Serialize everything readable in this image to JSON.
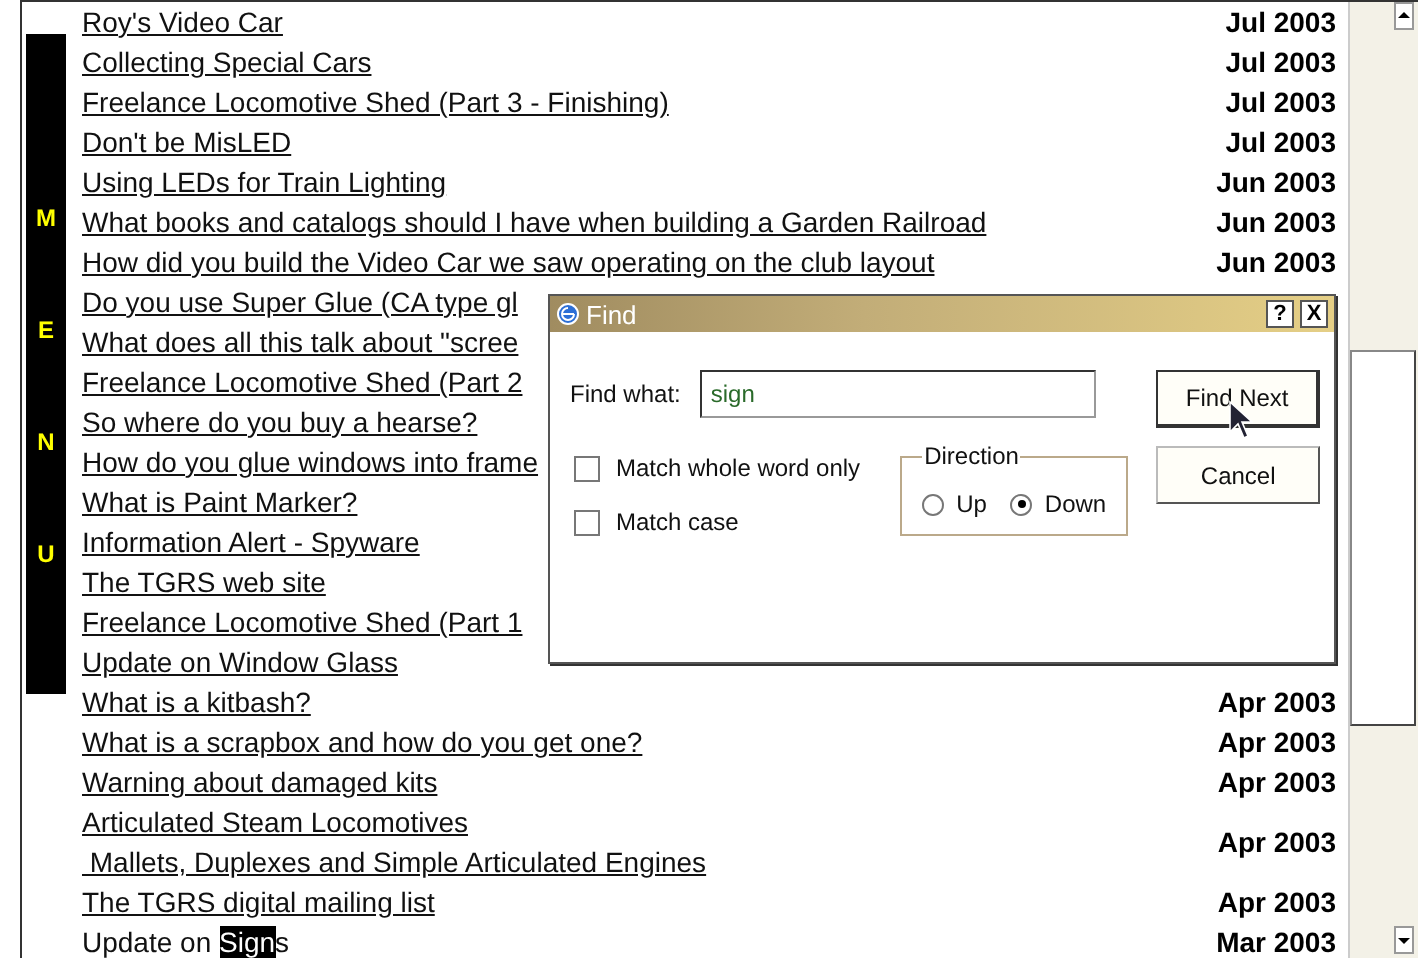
{
  "menu_bar": {
    "letters": [
      "M",
      "E",
      "N",
      "U"
    ]
  },
  "articles": [
    {
      "kind": "link",
      "title": "Roy's Video Car",
      "date": "Jul 2003"
    },
    {
      "kind": "link",
      "title": "Collecting Special Cars",
      "date": "Jul 2003"
    },
    {
      "kind": "link",
      "title": "Freelance Locomotive Shed (Part 3 - Finishing)",
      "date": "Jul 2003"
    },
    {
      "kind": "link",
      "title": "Don't be MisLED",
      "date": "Jul 2003"
    },
    {
      "kind": "link",
      "title": "Using LEDs for Train Lighting",
      "date": "Jun 2003"
    },
    {
      "kind": "link",
      "title": "What books and catalogs should I have when building a Garden Railroad",
      "date": "Jun 2003"
    },
    {
      "kind": "link",
      "title": "How did you build the Video Car we saw operating on the club layout",
      "date": "Jun 2003"
    },
    {
      "kind": "link",
      "title": "Do you use Super Glue (CA type gl"
    },
    {
      "kind": "link",
      "title": "What does all this talk about \"scree"
    },
    {
      "kind": "link",
      "title": "Freelance Locomotive Shed (Part 2"
    },
    {
      "kind": "link",
      "title": "So where do you buy a hearse?"
    },
    {
      "kind": "link",
      "title": "How do you glue windows into frame"
    },
    {
      "kind": "link",
      "title": "What is Paint Marker?"
    },
    {
      "kind": "link",
      "title": "Information Alert - Spyware"
    },
    {
      "kind": "link",
      "title": "The TGRS web site"
    },
    {
      "kind": "link",
      "title": "Freelance Locomotive Shed (Part 1"
    },
    {
      "kind": "link",
      "title": "Update on Window Glass"
    },
    {
      "kind": "link",
      "title": "What is a kitbash?",
      "date": "Apr 2003"
    },
    {
      "kind": "link",
      "title": "What is a scrapbox and how do you get one?",
      "date": "Apr 2003"
    },
    {
      "kind": "link",
      "title": "Warning about damaged kits",
      "date": "Apr 2003"
    },
    {
      "kind": "link",
      "title": "Articulated Steam Locomotives",
      "subtitle": " Mallets, Duplexes and Simple Articulated Engines",
      "date": "Apr 2003"
    },
    {
      "kind": "link",
      "title": "The TGRS digital mailing list",
      "date": "Apr 2003"
    },
    {
      "kind": "plain",
      "title": "Update on ",
      "highlight": "Sign",
      "title_end": "s",
      "date": "Mar 2003"
    }
  ],
  "find_dialog": {
    "title": "Find",
    "help_button": "?",
    "close_button": "X",
    "find_what_label": "Find what:",
    "find_what_value": "sign",
    "options": [
      {
        "label": "Match whole word only",
        "checked": false
      },
      {
        "label": "Match case",
        "checked": false
      }
    ],
    "direction": {
      "label": "Direction",
      "options": [
        {
          "label": "Up",
          "selected": false
        },
        {
          "label": "Down",
          "selected": true
        }
      ]
    },
    "buttons": [
      {
        "label": "Find Next"
      },
      {
        "label": "Cancel"
      }
    ]
  }
}
